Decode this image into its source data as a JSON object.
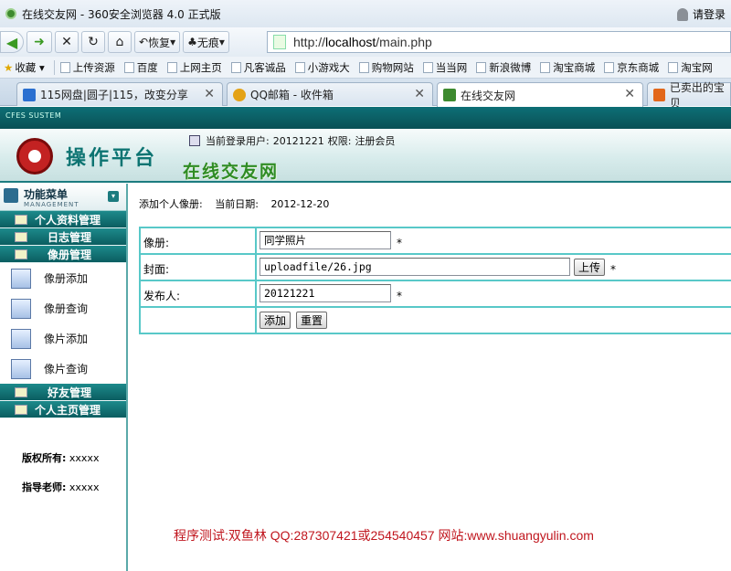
{
  "browser": {
    "window_title": "在线交友网 - 360安全浏览器 4.0 正式版",
    "login_text": "请登录",
    "nav": {
      "restore": "恢复",
      "no_trace": "无痕",
      "url_prefix": "http://",
      "url_host": "localhost",
      "url_path": "/main.php"
    },
    "favorites": {
      "collect": "收藏",
      "items": [
        "上传资源",
        "百度",
        "上网主页",
        "凡客诚品",
        "小游戏大",
        "购物网站",
        "当当网",
        "新浪微博",
        "淘宝商城",
        "京东商城",
        "淘宝网"
      ]
    },
    "tabs": [
      {
        "label": "115网盘|圆子|115，改变分享",
        "icon_color": "#2a6fd0"
      },
      {
        "label": "QQ邮箱 - 收件箱",
        "icon_color": "#e4a215"
      },
      {
        "label": "在线交友网",
        "icon_color": "#3d8a2f"
      },
      {
        "label": "已卖出的宝贝",
        "icon_color": "#e2671a"
      }
    ]
  },
  "page": {
    "system_tag": "CFES SUSTEM",
    "logo_text": "操作平台",
    "site_name": "在线交友网",
    "current_user_label": "当前登录用户:",
    "current_user": "20121221",
    "role_label": "权限:",
    "role": "注册会员"
  },
  "sidebar": {
    "menu_title": "功能菜单",
    "menu_subtitle": "MANAGEMENT",
    "categories": {
      "profile": "个人资料管理",
      "log": "日志管理",
      "album": "像册管理",
      "friends": "好友管理",
      "homepage": "个人主页管理"
    },
    "album_items": [
      "像册添加",
      "像册查询",
      "像片添加",
      "像片查询"
    ],
    "copyright_label": "版权所有:",
    "copyright_value": "xxxxx",
    "teacher_label": "指导老师:",
    "teacher_value": "xxxxx"
  },
  "main": {
    "heading": "添加个人像册:",
    "date_label": "当前日期:",
    "date": "2012-12-20",
    "form": {
      "album_label": "像册:",
      "album_value": "同学照片",
      "cover_label": "封面:",
      "cover_value": "uploadfile/26.jpg",
      "upload_button": "上传",
      "publisher_label": "发布人:",
      "publisher_value": "20121221",
      "required_mark": "*",
      "add_button": "添加",
      "reset_button": "重置"
    }
  },
  "footer_note": "程序测试:双鱼林 QQ:287307421或254540457 网站:www.shuangyulin.com"
}
